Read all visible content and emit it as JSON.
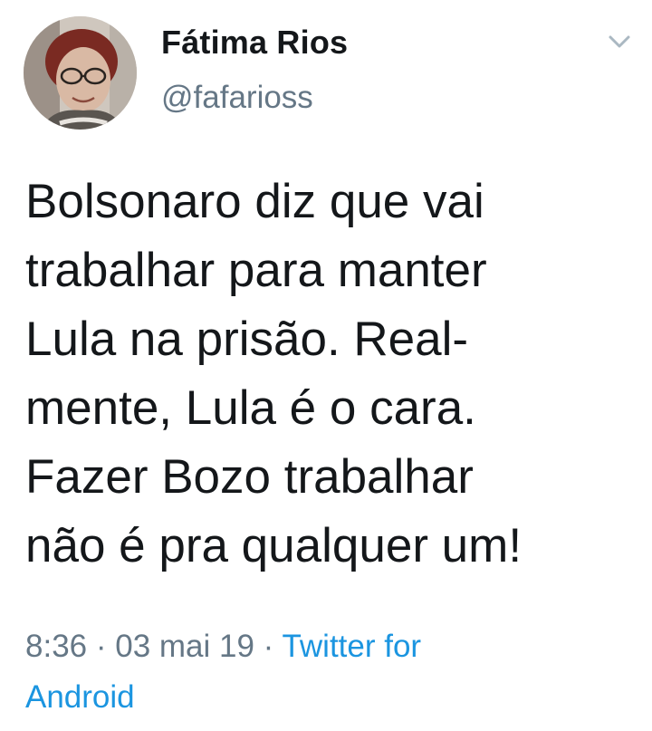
{
  "user": {
    "name": "Fátima Rios",
    "handle": "@fafarioss"
  },
  "tweet": {
    "lines": [
      "Bolsonaro diz que vai",
      "trabalhar para manter",
      "Lula na prisão. Real-",
      "mente, Lula é o cara.",
      "Fazer Bozo trabalhar",
      "não é pra qualquer um!"
    ],
    "time": "8:36",
    "date": "03 mai 19",
    "separator": " · ",
    "source_line1": "Twitter for",
    "source_line2": "Android"
  },
  "colors": {
    "text": "#14171a",
    "secondary": "#657786",
    "link": "#1b95e0"
  },
  "icons": {
    "menu": "chevron-down-icon"
  }
}
